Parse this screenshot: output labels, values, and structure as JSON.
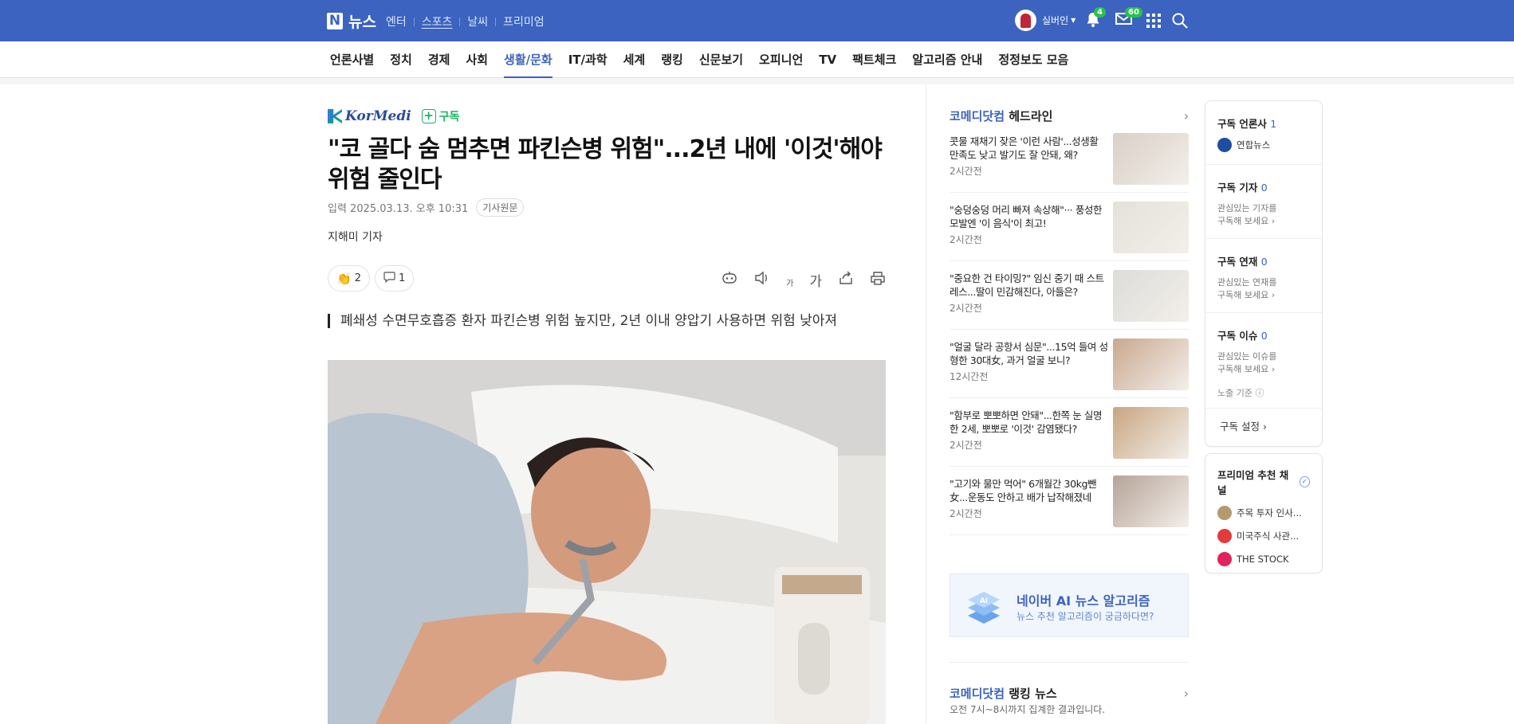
{
  "topbar": {
    "logo_letter": "N",
    "logo_text": "뉴스",
    "nav": [
      "엔터",
      "스포츠",
      "날씨",
      "프리미엄"
    ],
    "user_name": "실버인",
    "notif_count": "4",
    "mail_count": "60",
    "icons": [
      "bell-icon",
      "mail-icon",
      "apps-grid-icon",
      "search-icon"
    ]
  },
  "categories": [
    "언론사별",
    "정치",
    "경제",
    "사회",
    "생활/문화",
    "IT/과학",
    "세계",
    "랭킹",
    "신문보기",
    "오피니언",
    "TV",
    "팩트체크",
    "알고리즘 안내",
    "정정보도 모음"
  ],
  "active_category": "생활/문화",
  "article": {
    "press_name": "KorMedi",
    "subscribe_label": "구독",
    "headline_line1": "\"코 골다 숨 멈추면 파킨슨병 위험\"...2년 내에 '이것'해야",
    "headline_line2": "위험 줄인다",
    "date_text": "입력 2025.03.13. 오후 10:31",
    "original_label": "기사원문",
    "reporter": "지해미 기자",
    "like_count": "2",
    "comment_count": "1",
    "font_size_label": "가",
    "summary": "폐쇄성 수면무호흡증 환자 파킨슨병 위험 높지만, 2년 이내 양압기 사용하면 위험 낮아져"
  },
  "headline_section": {
    "press": "코메디닷컴",
    "title": "헤드라인",
    "items": [
      {
        "title": "콧물 재채기 잦은 '이런 사람'...성생활 만족도 낮고 발기도 잘 안돼, 왜?",
        "time": "2시간전",
        "thumb": "#d9cfc6"
      },
      {
        "title": "\"숭덩숭덩 머리 빠져 속상해\"··· 풍성한 모발엔 '이 음식'이 최고!",
        "time": "2시간전",
        "thumb": "#e4e1da"
      },
      {
        "title": "\"중요한 건 타이밍?\" 임신 중기 때 스트레스...딸이 민감해진다, 아들은?",
        "time": "2시간전",
        "thumb": "#dcdcd8"
      },
      {
        "title": "\"얼굴 달라 공항서 심문\"...15억 들여 성형한 30대女, 과거 얼굴 보니?",
        "time": "12시간전",
        "thumb": "#c9a88e"
      },
      {
        "title": "\"함부로 뽀뽀하면 안돼\"...한쪽 눈 실명한 2세, 뽀뽀로 '이것' 감염됐다?",
        "time": "2시간전",
        "thumb": "#c8a581"
      },
      {
        "title": "\"고기와 물만 먹어\" 6개월간 30kg뺀 女...운동도 안하고 배가 납작해졌네",
        "time": "2시간전",
        "thumb": "#b5a397"
      }
    ]
  },
  "ai_banner": {
    "title": "네이버 AI 뉴스 알고리즘",
    "subtitle": "뉴스 추천 알고리즘이 궁금하다면?",
    "icon_label": "AI"
  },
  "ranking": {
    "press": "코메디닷컴",
    "title": "랭킹 뉴스",
    "subtitle": "오전 7시~8시까지 집계한 결과입니다."
  },
  "subscriptions": {
    "press_label": "구독 언론사",
    "press_count": "1",
    "press_item": "연합뉴스",
    "reporter_label": "구독 기자",
    "reporter_count": "0",
    "reporter_desc1": "관심있는 기자를",
    "reporter_desc2": "구독해 보세요",
    "series_label": "구독 연재",
    "series_count": "0",
    "series_desc1": "관심있는 연재를",
    "series_desc2": "구독해 보세요",
    "issue_label": "구독 이슈",
    "issue_count": "0",
    "issue_desc1": "관심있는 이슈를",
    "issue_desc2": "구독해 보세요",
    "exposure": "노출 기준",
    "settings": "구독 설정"
  },
  "premium": {
    "title": "프리미엄 추천 채널",
    "channels": [
      {
        "name": "주목 투자 인사...",
        "color": "#b59a70"
      },
      {
        "name": "미국주식 사관...",
        "color": "#e23b3b"
      },
      {
        "name": "THE STOCK",
        "color": "#e0245e"
      }
    ]
  },
  "colors": {
    "brand": "#3b63bf",
    "accent_green": "#19b35e"
  }
}
